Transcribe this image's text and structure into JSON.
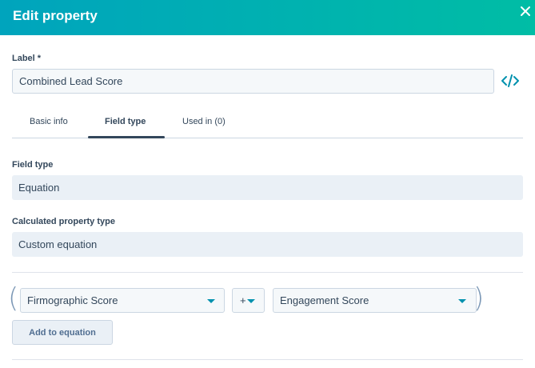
{
  "header": {
    "title": "Edit property"
  },
  "label_field": {
    "label": "Label *",
    "value": "Combined Lead Score"
  },
  "tabs": [
    {
      "label": "Basic info",
      "active": false
    },
    {
      "label": "Field type",
      "active": true
    },
    {
      "label": "Used in (0)",
      "active": false
    }
  ],
  "field_type": {
    "label": "Field type",
    "value": "Equation"
  },
  "calculated_type": {
    "label": "Calculated property type",
    "value": "Custom equation"
  },
  "equation": {
    "open_paren": "(",
    "close_paren": ")",
    "left_operand": "Firmographic Score",
    "operator": "+",
    "right_operand": "Engagement Score"
  },
  "add_button": {
    "label": "Add to equation"
  },
  "colors": {
    "header_start": "#00a4bd",
    "header_end": "#00bda5",
    "accent": "#0091ae",
    "text": "#33475b"
  },
  "icons": {
    "close": "close-icon",
    "code": "code-icon",
    "caret": "caret-down-icon"
  }
}
